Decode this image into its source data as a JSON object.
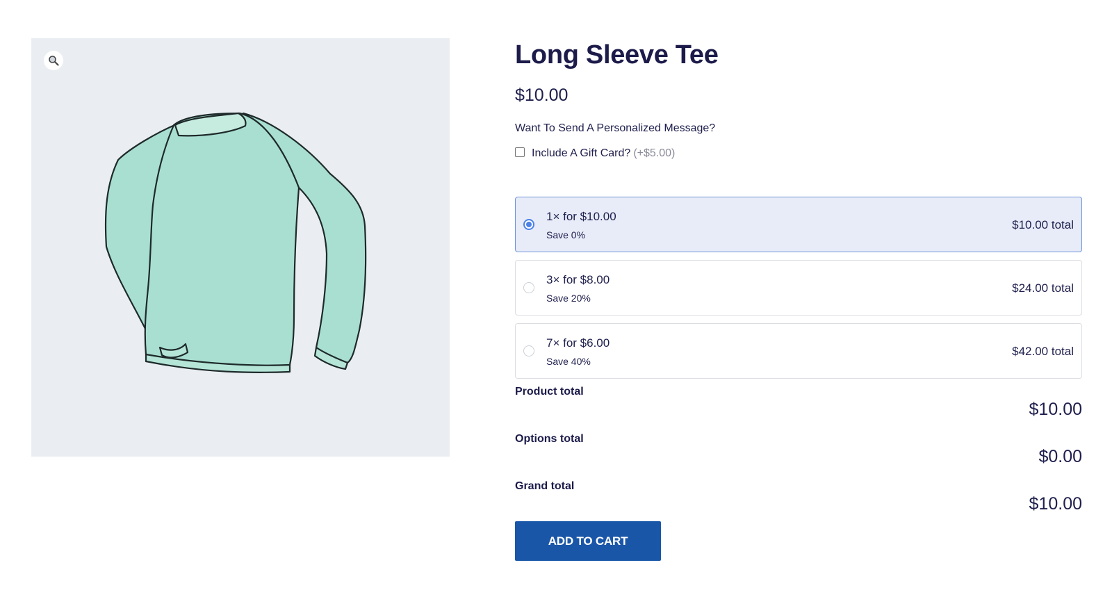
{
  "gallery": {
    "zoom_icon": "magnifier-icon",
    "image_subject": "mint green long sleeve tee illustration"
  },
  "product": {
    "title": "Long Sleeve Tee",
    "price": "$10.00"
  },
  "addons": {
    "heading": "Want To Send A Personalized Message?",
    "gift_card": {
      "label": "Include A Gift Card?",
      "price": "(+$5.00)",
      "checked": false
    }
  },
  "tiers": [
    {
      "label": "1× for $10.00",
      "save": "Save 0%",
      "total": "$10.00 total",
      "selected": true
    },
    {
      "label": "3× for $8.00",
      "save": "Save 20%",
      "total": "$24.00 total",
      "selected": false
    },
    {
      "label": "7× for $6.00",
      "save": "Save 40%",
      "total": "$42.00 total",
      "selected": false
    }
  ],
  "totals": {
    "product_label": "Product total",
    "product_value": "$10.00",
    "options_label": "Options total",
    "options_value": "$0.00",
    "grand_label": "Grand total",
    "grand_value": "$10.00"
  },
  "cart": {
    "button_label": "ADD TO CART"
  },
  "colors": {
    "button_bg": "#1a56a8",
    "selected_tier_bg": "#e7ecf8",
    "radio_accent": "#4d82e6",
    "image_bg": "#eaeef2",
    "shirt_fill": "#a8e0cf"
  }
}
